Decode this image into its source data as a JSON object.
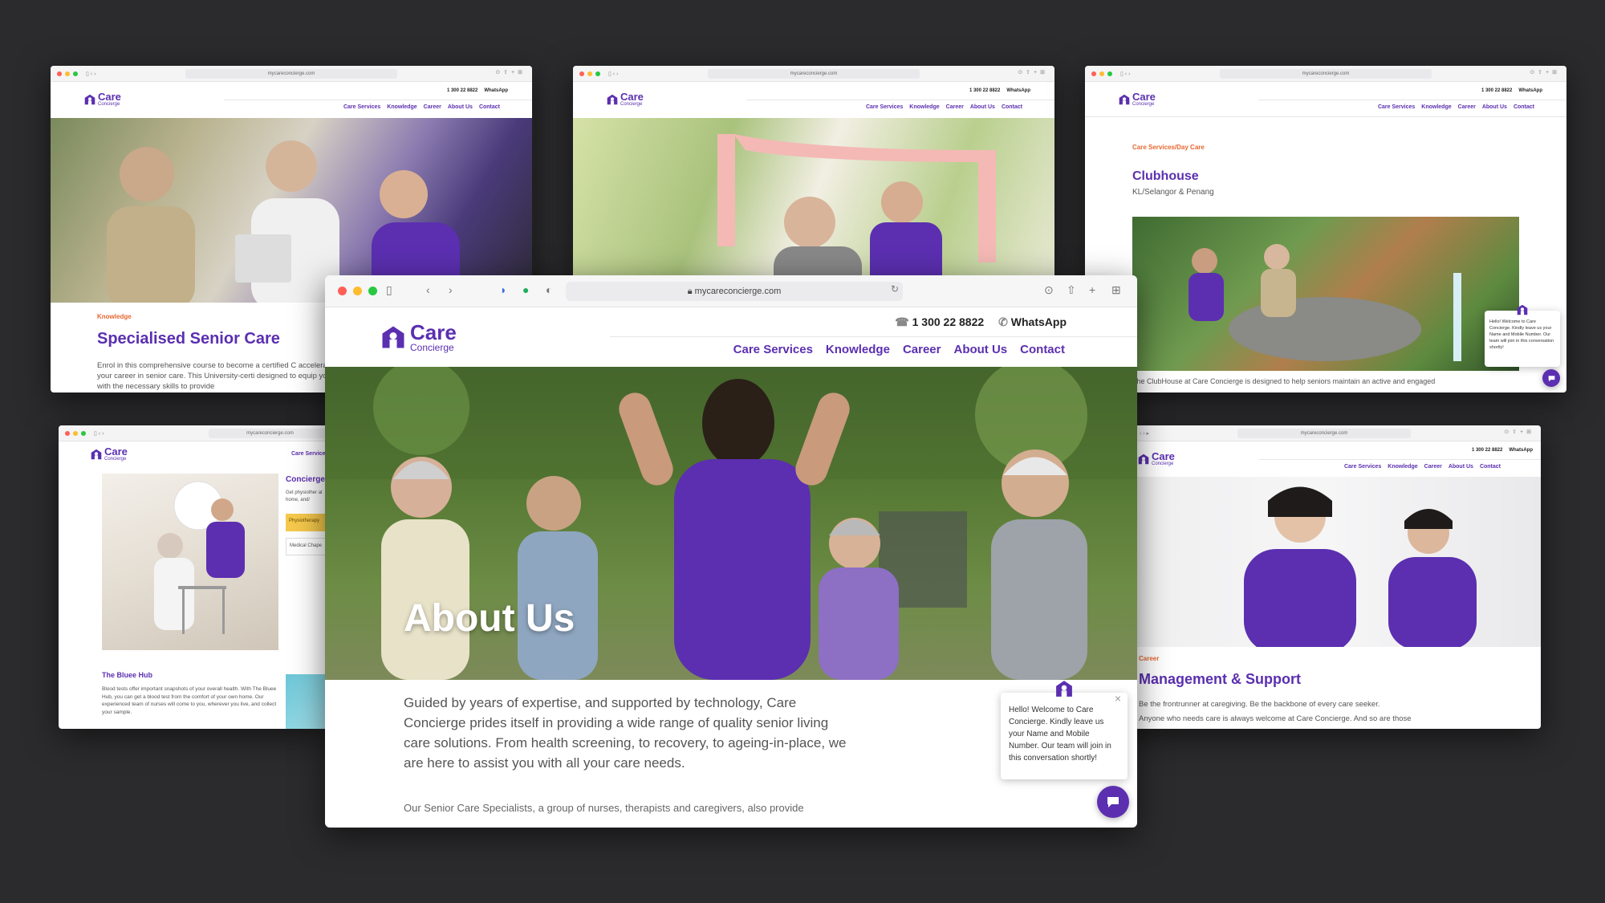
{
  "brand": {
    "name": "Care",
    "sub": "Concierge",
    "purple": "#5b2fb0",
    "orange": "#e8672e"
  },
  "browser": {
    "url": "mycareconcierge.com"
  },
  "header": {
    "phone": "1 300 22 8822",
    "whatsapp": "WhatsApp"
  },
  "nav": [
    "Care Services",
    "Knowledge",
    "Career",
    "About Us",
    "Contact"
  ],
  "windows": {
    "senior": {
      "kicker": "Knowledge",
      "title": "Specialised Senior Care",
      "body": "Enrol in this comprehensive course to become a certified C accelerate your career in senior care. This University-certi designed to equip you with the necessary skills to provide"
    },
    "exercise": {},
    "clubhouse": {
      "kicker": "Care Services/Day Care",
      "title": "Clubhouse",
      "subtitle": "KL/Selangor & Penang",
      "body": "The ClubHouse at Care Concierge is designed to help seniors maintain an active and engaged",
      "chat": "Hello! Welcome to Care Concierge. Kindly leave us your Name and Mobile Number. Our team will join in this conversation shortly!"
    },
    "bluee": {
      "side_title": "Concierge",
      "side_text": "Get physiother at home, and/",
      "tag1": "Physiotherapy",
      "tag2": "Medical Chape",
      "title": "The Bluee Hub",
      "body": "Blood tests offer important snapshots of your overall health. With The Bluee Hub, you can get a blood test from the comfort of your own home. Our experienced team of nurses will come to you, wherever you live, and collect your sample."
    },
    "career": {
      "kicker": "Career",
      "title": "Management & Support",
      "body1": "Be the frontrunner at caregiving. Be the backbone of every care seeker.",
      "body2": "Anyone who needs care is always welcome at Care Concierge. And so are those"
    },
    "main": {
      "hero_title": "About Us",
      "intro": "Guided by years of expertise, and supported by technology, Care Concierge prides itself in providing a wide range of quality senior living care solutions. From health screening, to recovery, to ageing-in-place, we are here to assist you with all your care needs.",
      "para": "Our Senior Care Specialists, a group of nurses, therapists and caregivers, also provide",
      "chat": "Hello! Welcome to Care Concierge. Kindly leave us your Name and Mobile Number. Our team will join in this conversation shortly!",
      "close": "×"
    }
  },
  "icons": [
    "logo-icon",
    "phone-icon",
    "whatsapp-icon",
    "chat-icon",
    "close-icon",
    "back-icon",
    "forward-icon",
    "sidebar-icon",
    "download-icon",
    "share-icon",
    "new-tab-icon",
    "tabs-icon",
    "lock-icon",
    "reload-icon"
  ]
}
